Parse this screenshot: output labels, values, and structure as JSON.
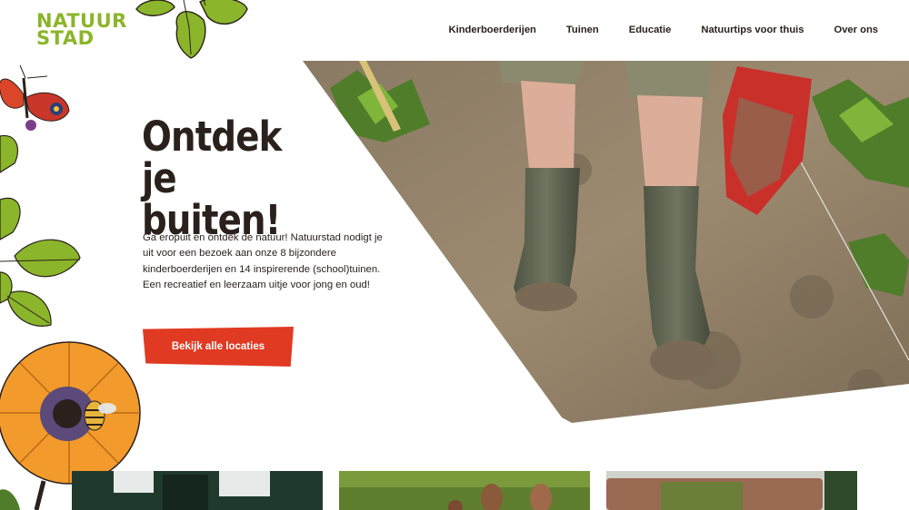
{
  "logo": {
    "line1": "NATUUR",
    "line2": "STAD"
  },
  "nav": {
    "items": [
      {
        "label": "Kinderboerderijen"
      },
      {
        "label": "Tuinen"
      },
      {
        "label": "Educatie"
      },
      {
        "label": "Natuurtips voor thuis"
      },
      {
        "label": "Over ons"
      }
    ]
  },
  "hero": {
    "title_line1": "Ontdek je",
    "title_line2": "buiten!",
    "text": "Ga eropuit en ontdek de natuur! Natuurstad nodigt je uit voor een bezoek aan onze 8 bijzondere kinderboerderijen en 14 inspirerende (school)tuinen. Een recreatief en leerzaam uitje voor jong en oud!",
    "cta_label": "Bekijk alle locaties"
  },
  "colors": {
    "brand_green": "#8bb52a",
    "cta_red": "#e03a22",
    "text_dark": "#2a211c"
  },
  "icons": [
    "logo-leaves",
    "butterfly-icon",
    "leaf-cluster",
    "sunflower-icon",
    "bee-icon"
  ]
}
